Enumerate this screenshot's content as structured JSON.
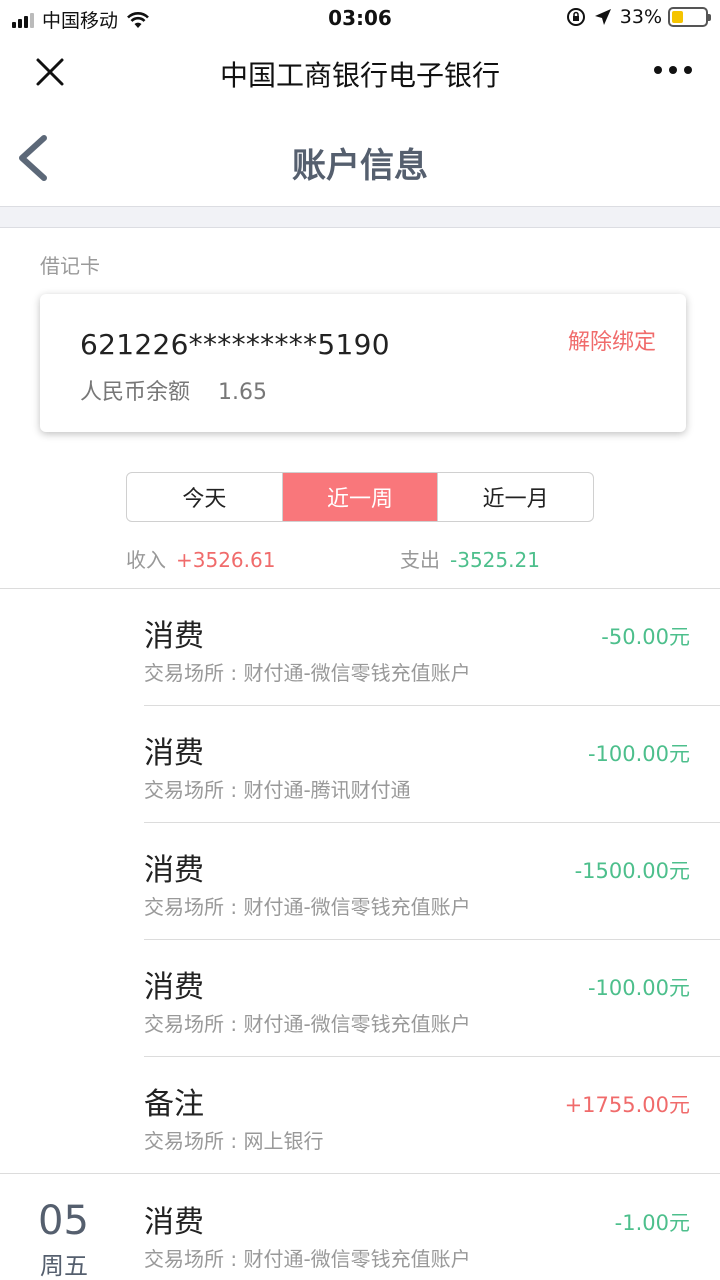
{
  "status_bar": {
    "carrier": "中国移动",
    "time": "03:06",
    "battery_percent": "33%",
    "battery_level": 0.33
  },
  "wechat_bar": {
    "title": "中国工商银行电子银行"
  },
  "nav": {
    "title": "账户信息"
  },
  "card": {
    "type_label": "借记卡",
    "number": "621226*********5190",
    "balance_label": "人民币余额",
    "balance_value": "1.65",
    "unbind_label": "解除绑定"
  },
  "segments": [
    {
      "label": "今天",
      "active": false
    },
    {
      "label": "近一周",
      "active": true
    },
    {
      "label": "近一月",
      "active": false
    }
  ],
  "summary": {
    "income_label": "收入",
    "income_value": "+3526.61",
    "expense_label": "支出",
    "expense_value": "-3525.21"
  },
  "transactions": [
    {
      "type": "消费",
      "place": "交易场所 : 财付通-微信零钱充值账户",
      "amount": "-50.00元"
    },
    {
      "type": "消费",
      "place": "交易场所 : 财付通-腾讯财付通",
      "amount": "-100.00元"
    },
    {
      "type": "消费",
      "place": "交易场所 : 财付通-微信零钱充值账户",
      "amount": "-1500.00元"
    },
    {
      "type": "消费",
      "place": "交易场所 : 财付通-微信零钱充值账户",
      "amount": "-100.00元"
    },
    {
      "type": "备注",
      "place": "交易场所 : 网上银行",
      "amount": "+1755.00元"
    }
  ],
  "group2": {
    "day": "05",
    "weekday": "周五",
    "transaction": {
      "type": "消费",
      "place": "交易场所 : 财付通-微信零钱充值账户",
      "amount": "-1.00元"
    }
  },
  "colors": {
    "accent": "#f9777b",
    "income": "#f06b6b",
    "expense": "#4dbf8c"
  }
}
